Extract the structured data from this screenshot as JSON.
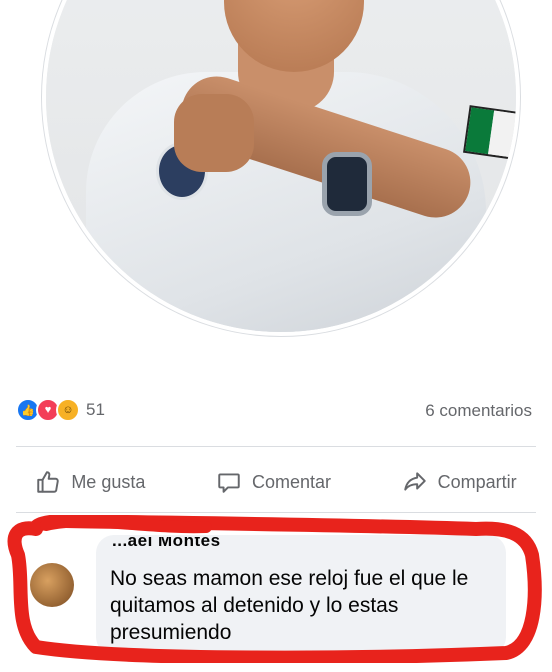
{
  "post": {
    "reactions": {
      "icons": [
        "like-icon",
        "love-icon",
        "haha-icon"
      ],
      "count": "51"
    },
    "comments_count": "6 comentarios"
  },
  "actions": {
    "like_label": "Me gusta",
    "comment_label": "Comentar",
    "share_label": "Compartir"
  },
  "comment": {
    "author": "...ael Montes",
    "text": "No seas mamon ese reloj fue el que le quitamos al detenido y lo estas presumiendo"
  },
  "colors": {
    "like_blue": "#1877f2",
    "love_red": "#f33e58",
    "haha_yellow": "#f7b125",
    "secondary_text": "#65676b",
    "annotation_red": "#e8231c"
  }
}
